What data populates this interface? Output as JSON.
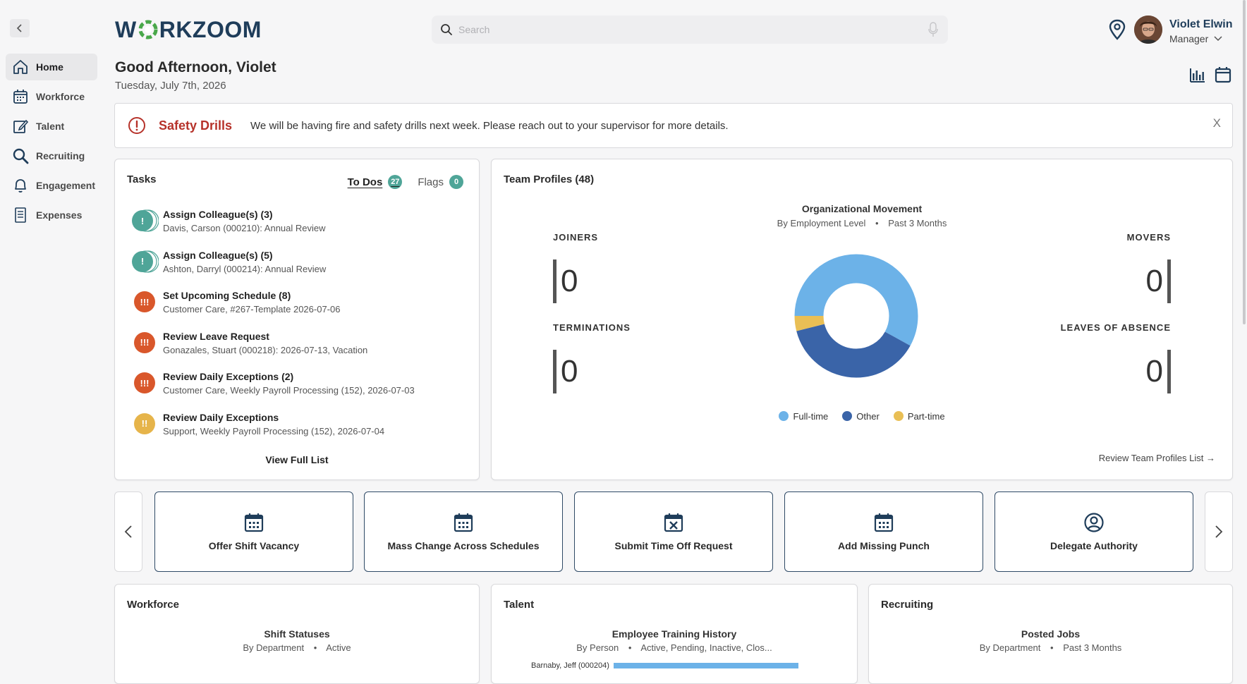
{
  "sidebar": {
    "items": [
      {
        "label": "Home",
        "icon": "home-icon"
      },
      {
        "label": "Workforce",
        "icon": "calendar-icon"
      },
      {
        "label": "Talent",
        "icon": "edit-icon"
      },
      {
        "label": "Recruiting",
        "icon": "search-icon"
      },
      {
        "label": "Engagement",
        "icon": "bell-icon"
      },
      {
        "label": "Expenses",
        "icon": "receipt-icon"
      }
    ]
  },
  "header": {
    "logo_left": "W",
    "logo_right": "RKZOOM",
    "search_placeholder": "Search",
    "user_name": "Violet Elwin",
    "user_role": "Manager"
  },
  "greeting": "Good Afternoon, Violet",
  "date": "Tuesday, July 7th, 2026",
  "banner": {
    "title": "Safety Drills",
    "message": "We will be having fire and safety drills next week. Please reach out to your supervisor for more details.",
    "close": "X"
  },
  "tasks": {
    "title": "Tasks",
    "tabs": [
      {
        "label": "To Dos",
        "count": "27"
      },
      {
        "label": "Flags",
        "count": "0"
      }
    ],
    "items": [
      {
        "title": "Assign Colleague(s) (3)",
        "subtitle": "Davis, Carson (000210): Annual Review",
        "priority": "!",
        "color": "#4fa598"
      },
      {
        "title": "Assign Colleague(s) (5)",
        "subtitle": "Ashton, Darryl (000214): Annual Review",
        "priority": "!",
        "color": "#4fa598"
      },
      {
        "title": "Set Upcoming Schedule (8)",
        "subtitle": "Customer Care, #267-Template 2026-07-06",
        "priority": "!!!",
        "color": "#d9572b"
      },
      {
        "title": "Review Leave Request",
        "subtitle": "Gonazales, Stuart (000218): 2026-07-13, Vacation",
        "priority": "!!!",
        "color": "#d9572b"
      },
      {
        "title": "Review Daily Exceptions (2)",
        "subtitle": "Customer Care, Weekly Payroll Processing (152), 2026-07-03",
        "priority": "!!!",
        "color": "#d9572b"
      },
      {
        "title": "Review Daily Exceptions",
        "subtitle": "Support, Weekly Payroll Processing (152), 2026-07-04",
        "priority": "!!",
        "color": "#e6b44a"
      }
    ],
    "view_full": "View Full List"
  },
  "team": {
    "title": "Team Profiles (48)",
    "chart_title": "Organizational Movement",
    "chart_sub_a": "By Employment Level",
    "chart_sub_b": "Past 3 Months",
    "joiners_label": "JOINERS",
    "joiners": "0",
    "movers_label": "MOVERS",
    "movers": "0",
    "terminations_label": "TERMINATIONS",
    "terminations": "0",
    "leaves_label": "LEAVES OF ABSENCE",
    "leaves": "0",
    "review_link": "Review Team Profiles List →"
  },
  "chart_data": {
    "type": "pie",
    "categories": [
      "Full-time",
      "Other",
      "Part-time"
    ],
    "values": [
      58,
      38,
      4
    ],
    "colors": [
      "#6cb2e8",
      "#3a64a8",
      "#e9bf55"
    ],
    "title": "Organizational Movement"
  },
  "actions": [
    {
      "label": "Offer Shift Vacancy",
      "icon": "calendar-icon"
    },
    {
      "label": "Mass Change Across Schedules",
      "icon": "calendar-icon"
    },
    {
      "label": "Submit Time Off Request",
      "icon": "calendar-cancel-icon"
    },
    {
      "label": "Add Missing Punch",
      "icon": "calendar-icon"
    },
    {
      "label": "Delegate Authority",
      "icon": "user-circle-icon"
    }
  ],
  "bottom": {
    "workforce": {
      "title": "Workforce",
      "chart_title": "Shift Statuses",
      "sub_a": "By Department",
      "sub_b": "Active"
    },
    "talent": {
      "title": "Talent",
      "chart_title": "Employee Training History",
      "sub_a": "By Person",
      "sub_b": "Active, Pending, Inactive, Clos...",
      "row_label": "Barnaby, Jeff (000204)"
    },
    "recruiting": {
      "title": "Recruiting",
      "chart_title": "Posted Jobs",
      "sub_a": "By Department",
      "sub_b": "Past 3 Months"
    }
  }
}
